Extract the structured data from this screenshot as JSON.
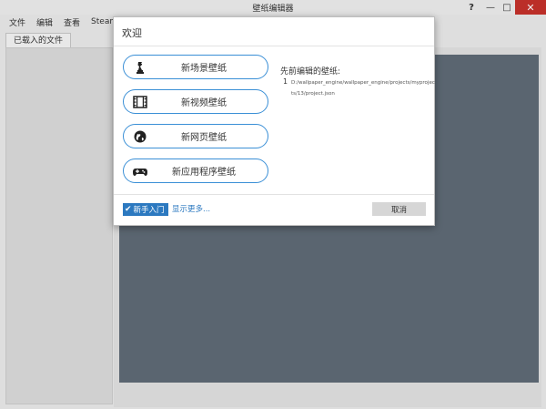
{
  "window": {
    "title": "壁纸编辑器",
    "help": "?",
    "min": "—",
    "max": "□",
    "close": "✕"
  },
  "menu": [
    "文件",
    "编辑",
    "查看",
    "Steam"
  ],
  "tabs": {
    "loaded_files": "已载入的文件"
  },
  "dialog": {
    "title": "欢迎",
    "buttons": [
      {
        "label": "新场景壁纸",
        "icon": "chess-piece-icon"
      },
      {
        "label": "新视频壁纸",
        "icon": "film-icon"
      },
      {
        "label": "新网页壁纸",
        "icon": "globe-icon"
      },
      {
        "label": "新应用程序壁纸",
        "icon": "gamepad-icon"
      }
    ],
    "recent": {
      "title": "先前编辑的壁纸:",
      "items": [
        {
          "num": "1",
          "path": "D:/wallpaper_engine/wallpaper_engine/projects/myprojects/13/project.json"
        }
      ]
    },
    "starter_label": "新手入门",
    "show_more": "显示更多...",
    "cancel": "取消"
  },
  "colors": {
    "accent": "#2c79c0",
    "canvas": "#606c78",
    "close": "#c7312b"
  }
}
